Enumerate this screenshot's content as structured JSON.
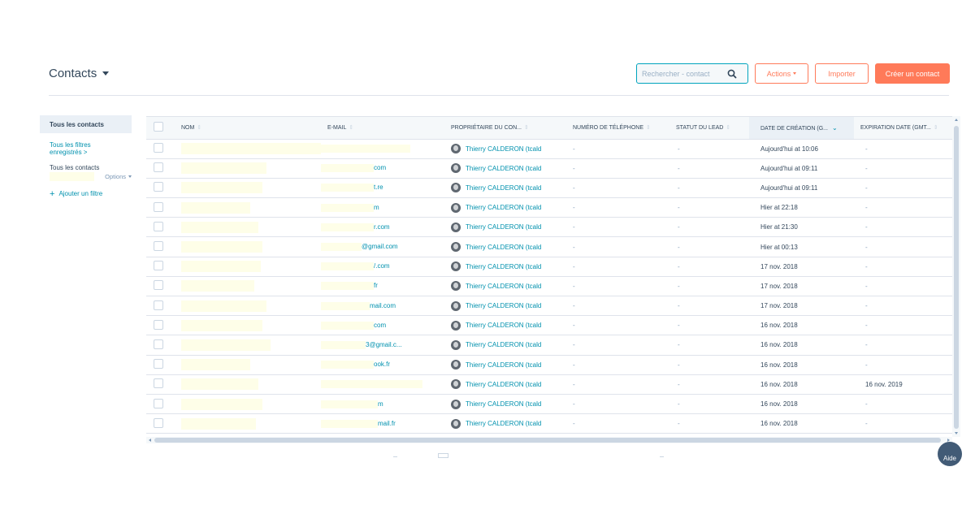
{
  "header": {
    "title": "Contacts",
    "search_placeholder": "Rechercher - contact",
    "actions_label": "Actions",
    "import_label": "Importer",
    "create_label": "Créer un contact"
  },
  "sidebar": {
    "all_contacts": "Tous les contacts",
    "saved_filters": "Tous les filtres enregistrés >",
    "current_view": "Tous les contacts",
    "options_label": "Options",
    "add_filter": "Ajouter un filtre"
  },
  "table": {
    "columns": [
      "NOM",
      "E-MAIL",
      "PROPRIÉTAIRE DU CON...",
      "NUMÉRO DE TÉLÉPHONE",
      "STATUT DU LEAD",
      "DATE DE CRÉATION (G...",
      "EXPIRATION DATE (GMT..."
    ],
    "rows": [
      {
        "email": "",
        "owner": "Thierry CALDERON (tcald",
        "phone": "-",
        "lead": "-",
        "created": "Aujourd'hui at 10:06",
        "expiration": "-"
      },
      {
        "email": "com",
        "owner": "Thierry CALDERON (tcald",
        "phone": "-",
        "lead": "-",
        "created": "Aujourd'hui at 09:11",
        "expiration": "-"
      },
      {
        "email": "t.re",
        "owner": "Thierry CALDERON (tcald",
        "phone": "-",
        "lead": "-",
        "created": "Aujourd'hui at 09:11",
        "expiration": "-"
      },
      {
        "email": "m",
        "owner": "Thierry CALDERON (tcald",
        "phone": "-",
        "lead": "-",
        "created": "Hier at 22:18",
        "expiration": "-"
      },
      {
        "email": "r.com",
        "owner": "Thierry CALDERON (tcald",
        "phone": "-",
        "lead": "-",
        "created": "Hier at 21:30",
        "expiration": "-"
      },
      {
        "email": "@gmail.com",
        "owner": "Thierry CALDERON (tcald",
        "phone": "-",
        "lead": "-",
        "created": "Hier at 00:13",
        "expiration": "-"
      },
      {
        "email": "/.com",
        "owner": "Thierry CALDERON (tcald",
        "phone": "-",
        "lead": "-",
        "created": "17 nov. 2018",
        "expiration": "-"
      },
      {
        "email": "fr",
        "owner": "Thierry CALDERON (tcald",
        "phone": "-",
        "lead": "-",
        "created": "17 nov. 2018",
        "expiration": "-"
      },
      {
        "email": "mail.com",
        "owner": "Thierry CALDERON (tcald",
        "phone": "-",
        "lead": "-",
        "created": "17 nov. 2018",
        "expiration": "-"
      },
      {
        "email": "com",
        "owner": "Thierry CALDERON (tcald",
        "phone": "-",
        "lead": "-",
        "created": "16 nov. 2018",
        "expiration": "-"
      },
      {
        "email": "3@gmail.c...",
        "owner": "Thierry CALDERON (tcald",
        "phone": "-",
        "lead": "-",
        "created": "16 nov. 2018",
        "expiration": "-"
      },
      {
        "email": "ook.fr",
        "owner": "Thierry CALDERON (tcald",
        "phone": "-",
        "lead": "-",
        "created": "16 nov. 2018",
        "expiration": "-"
      },
      {
        "email": "",
        "owner": "Thierry CALDERON (tcald",
        "phone": "-",
        "lead": "-",
        "created": "16 nov. 2018",
        "expiration": "16 nov. 2019"
      },
      {
        "email": "m",
        "owner": "Thierry CALDERON (tcald",
        "phone": "-",
        "lead": "-",
        "created": "16 nov. 2018",
        "expiration": "-"
      },
      {
        "email": "mail.fr",
        "owner": "Thierry CALDERON (tcald",
        "phone": "-",
        "lead": "-",
        "created": "16 nov. 2018",
        "expiration": "-"
      }
    ]
  },
  "help": {
    "label": "Aide"
  },
  "colors": {
    "accent": "#ff7a59",
    "link": "#0091ae",
    "text": "#33475b",
    "border": "#dfe3eb",
    "redaction": "#fefee8"
  }
}
